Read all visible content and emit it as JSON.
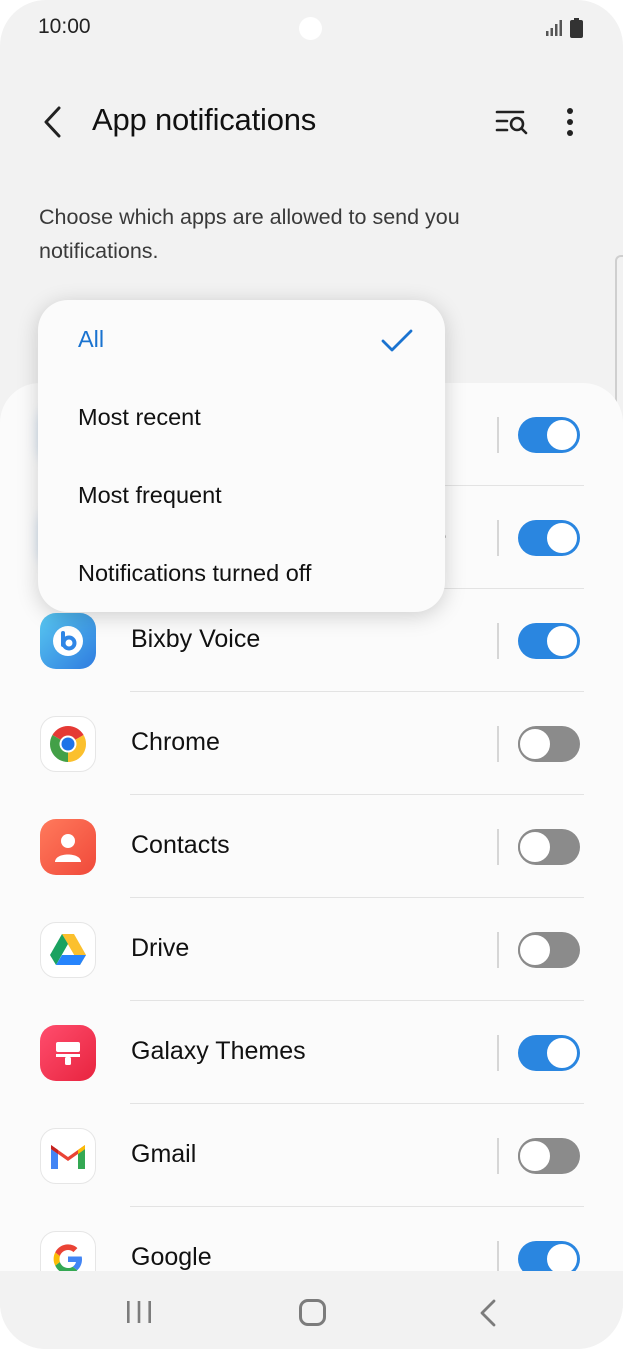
{
  "status_bar": {
    "time": "10:00"
  },
  "header": {
    "title": "App notifications"
  },
  "description": "Choose which apps are allowed to send you notifications.",
  "dropdown": {
    "items": [
      {
        "label": "All",
        "selected": true
      },
      {
        "label": "Most recent",
        "selected": false
      },
      {
        "label": "Most frequent",
        "selected": false
      },
      {
        "label": "Notifications turned off",
        "selected": false
      }
    ]
  },
  "apps": [
    {
      "name": "",
      "icon": "blurred-app-icon",
      "notifications_on": true
    },
    {
      "name": "ce",
      "icon": "blurred-app-icon",
      "notifications_on": true
    },
    {
      "name": "Bixby Voice",
      "icon": "bixby-icon",
      "notifications_on": true
    },
    {
      "name": "Chrome",
      "icon": "chrome-icon",
      "notifications_on": false
    },
    {
      "name": "Contacts",
      "icon": "contacts-icon",
      "notifications_on": false
    },
    {
      "name": "Drive",
      "icon": "drive-icon",
      "notifications_on": false
    },
    {
      "name": "Galaxy Themes",
      "icon": "galaxy-themes-icon",
      "notifications_on": true
    },
    {
      "name": "Gmail",
      "icon": "gmail-icon",
      "notifications_on": false
    },
    {
      "name": "Google",
      "icon": "google-icon",
      "notifications_on": true
    }
  ],
  "colors": {
    "accent": "#2a86e0",
    "toggle_off": "#8b8b8b",
    "selected_text": "#1a73d0"
  }
}
